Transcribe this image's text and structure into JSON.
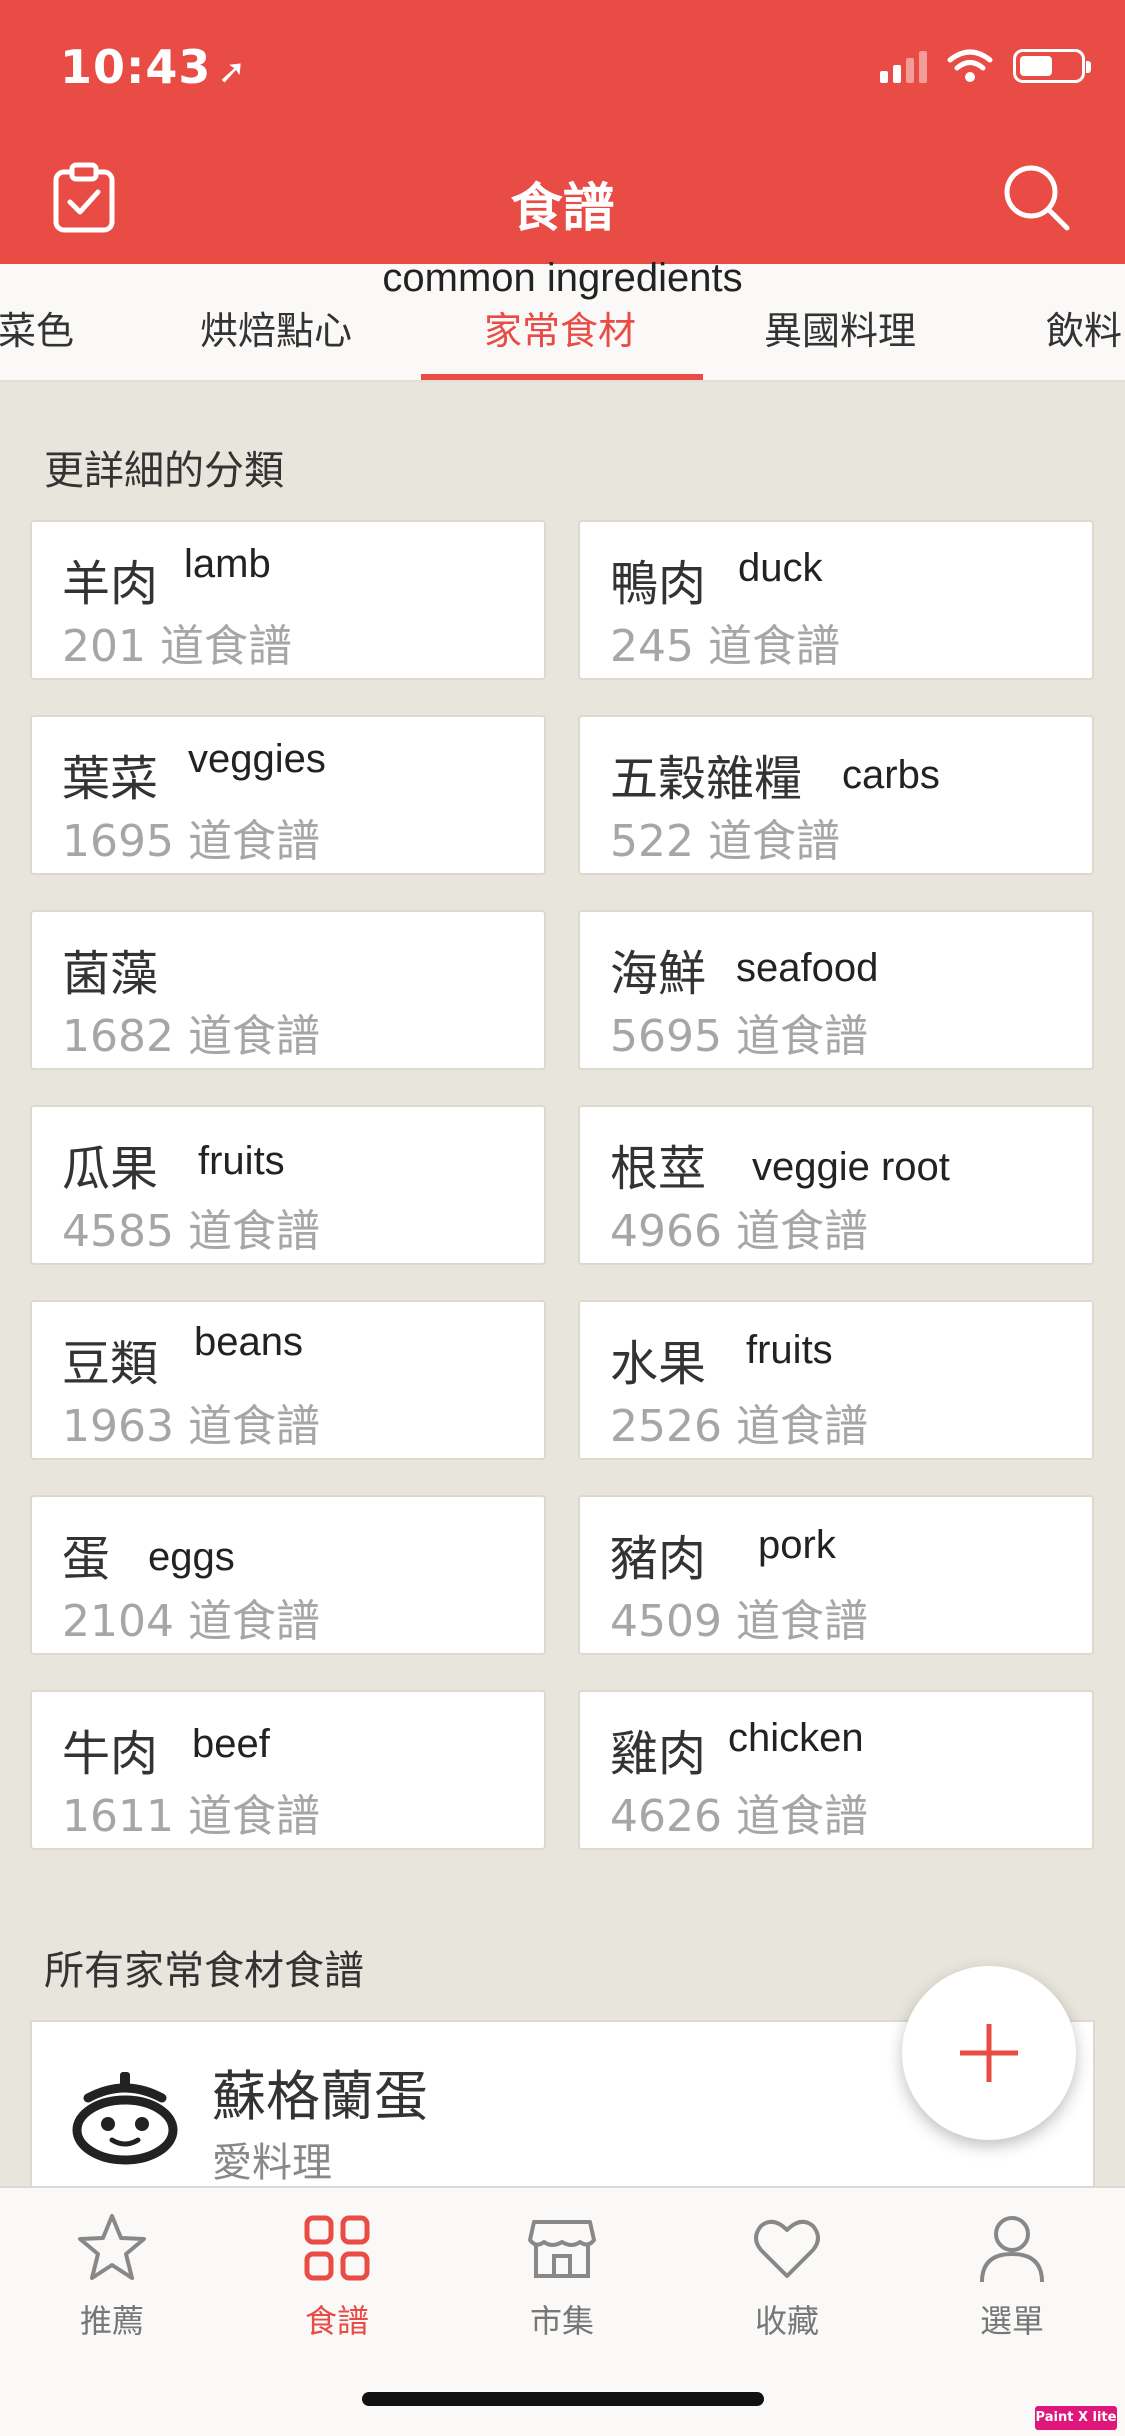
{
  "status": {
    "time": "10:43"
  },
  "header": {
    "title": "食譜"
  },
  "tabs": [
    {
      "label": "菜色"
    },
    {
      "label": "烘焙點心"
    },
    {
      "label": "家常食材",
      "annotation": "common ingredients"
    },
    {
      "label": "異國料理"
    },
    {
      "label": "飲料"
    }
  ],
  "sections": {
    "detail_title": "更詳細的分類",
    "all_title": "所有家常食材食譜"
  },
  "categories": [
    {
      "name": "羊肉",
      "en": "lamb",
      "count": "201 道食譜"
    },
    {
      "name": "鴨肉",
      "en": "duck",
      "count": "245 道食譜"
    },
    {
      "name": "葉菜",
      "en": "veggies",
      "count": "1695 道食譜"
    },
    {
      "name": "五穀雜糧",
      "en": "carbs",
      "count": "522 道食譜"
    },
    {
      "name": "菌藻",
      "en": "",
      "count": "1682 道食譜"
    },
    {
      "name": "海鮮",
      "en": "seafood",
      "count": "5695 道食譜"
    },
    {
      "name": "瓜果",
      "en": "fruits",
      "count": "4585 道食譜"
    },
    {
      "name": "根莖",
      "en": "veggie root",
      "count": "4966 道食譜"
    },
    {
      "name": "豆類",
      "en": "beans",
      "count": "1963 道食譜"
    },
    {
      "name": "水果",
      "en": "fruits",
      "count": "2526 道食譜"
    },
    {
      "name": "蛋",
      "en": "eggs",
      "count": "2104 道食譜"
    },
    {
      "name": "豬肉",
      "en": "pork",
      "count": "4509 道食譜"
    },
    {
      "name": "牛肉",
      "en": "beef",
      "count": "1611 道食譜"
    },
    {
      "name": "雞肉",
      "en": "chicken",
      "count": "4626 道食譜"
    }
  ],
  "recipe": {
    "name": "蘇格蘭蛋",
    "author": "愛料理"
  },
  "nav": [
    {
      "label": "推薦",
      "icon": "star-icon"
    },
    {
      "label": "食譜",
      "icon": "grid-icon"
    },
    {
      "label": "市集",
      "icon": "store-icon"
    },
    {
      "label": "收藏",
      "icon": "heart-icon"
    },
    {
      "label": "選單",
      "icon": "person-icon"
    }
  ],
  "watermark": "Paint X lite",
  "colors": {
    "accent": "#e94b45",
    "background": "#e8e5dc",
    "muted": "#a6a6a6"
  }
}
